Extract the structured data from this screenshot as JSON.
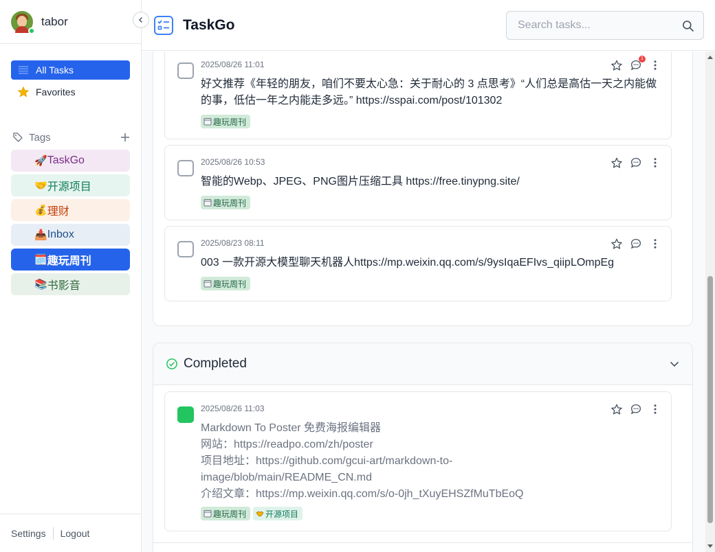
{
  "user": {
    "name": "tabor"
  },
  "app": {
    "title": "TaskGo"
  },
  "search": {
    "placeholder": "Search tasks..."
  },
  "nav": [
    {
      "label": "All Tasks",
      "icon": "list-icon"
    },
    {
      "label": "Favorites",
      "icon": "star-icon"
    }
  ],
  "tags_header": {
    "label": "Tags"
  },
  "tags": [
    {
      "emoji": "🚀",
      "label": "TaskGo",
      "bg": "#f3e8f3",
      "color": "#7b2f8a"
    },
    {
      "emoji": "🤝",
      "label": "开源项目",
      "bg": "#e6f5ef",
      "color": "#137a5c"
    },
    {
      "emoji": "💰",
      "label": "理财",
      "bg": "#fdf0e6",
      "color": "#c2410c"
    },
    {
      "emoji": "📥",
      "label": "Inbox",
      "bg": "#e8eef5",
      "color": "#1e4e8c"
    },
    {
      "emoji": "🗓️",
      "label": "趣玩周刊",
      "bg": "#2563eb",
      "color": "#ffffff"
    },
    {
      "emoji": "📚",
      "label": "书影音",
      "bg": "#e8f0ea",
      "color": "#2f6b3c"
    }
  ],
  "footer": {
    "settings": "Settings",
    "logout": "Logout"
  },
  "tasks": [
    {
      "date": "2025/08/26 11:01",
      "text": "好文推荐《年轻的朋友，咱们不要太心急：关于耐心的 3 点思考》“人们总是高估一天之内能做的事，低估一年之内能走多远。” https://sspai.com/post/101302",
      "comment_badge": "1",
      "tags": [
        "趣玩周刊"
      ]
    },
    {
      "date": "2025/08/26 10:53",
      "text": "智能的Webp、JPEG、PNG图片压缩工具 https://free.tinypng.site/",
      "tags": [
        "趣玩周刊"
      ]
    },
    {
      "date": "2025/08/23 08:11",
      "text": "003 一款开源大模型聊天机器人https://mp.weixin.qq.com/s/9ysIqaEFIvs_qiipLOmpEg",
      "tags": [
        "趣玩周刊"
      ]
    }
  ],
  "completed": {
    "label": "Completed",
    "task": {
      "date": "2025/08/26 11:03",
      "lines": [
        "Markdown To Poster 免费海报编辑器",
        "网站：https://readpo.com/zh/poster",
        "项目地址：https://github.com/gcui-art/markdown-to-",
        "image/blob/main/README_CN.md",
        "介绍文章：https://mp.weixin.qq.com/s/o-0jh_tXuyEHSZfMuTbEoQ"
      ],
      "tags": [
        "趣玩周刊",
        "开源项目"
      ]
    }
  },
  "colors": {
    "accent": "#2563eb",
    "success": "#22c55e",
    "danger": "#ef4444"
  }
}
